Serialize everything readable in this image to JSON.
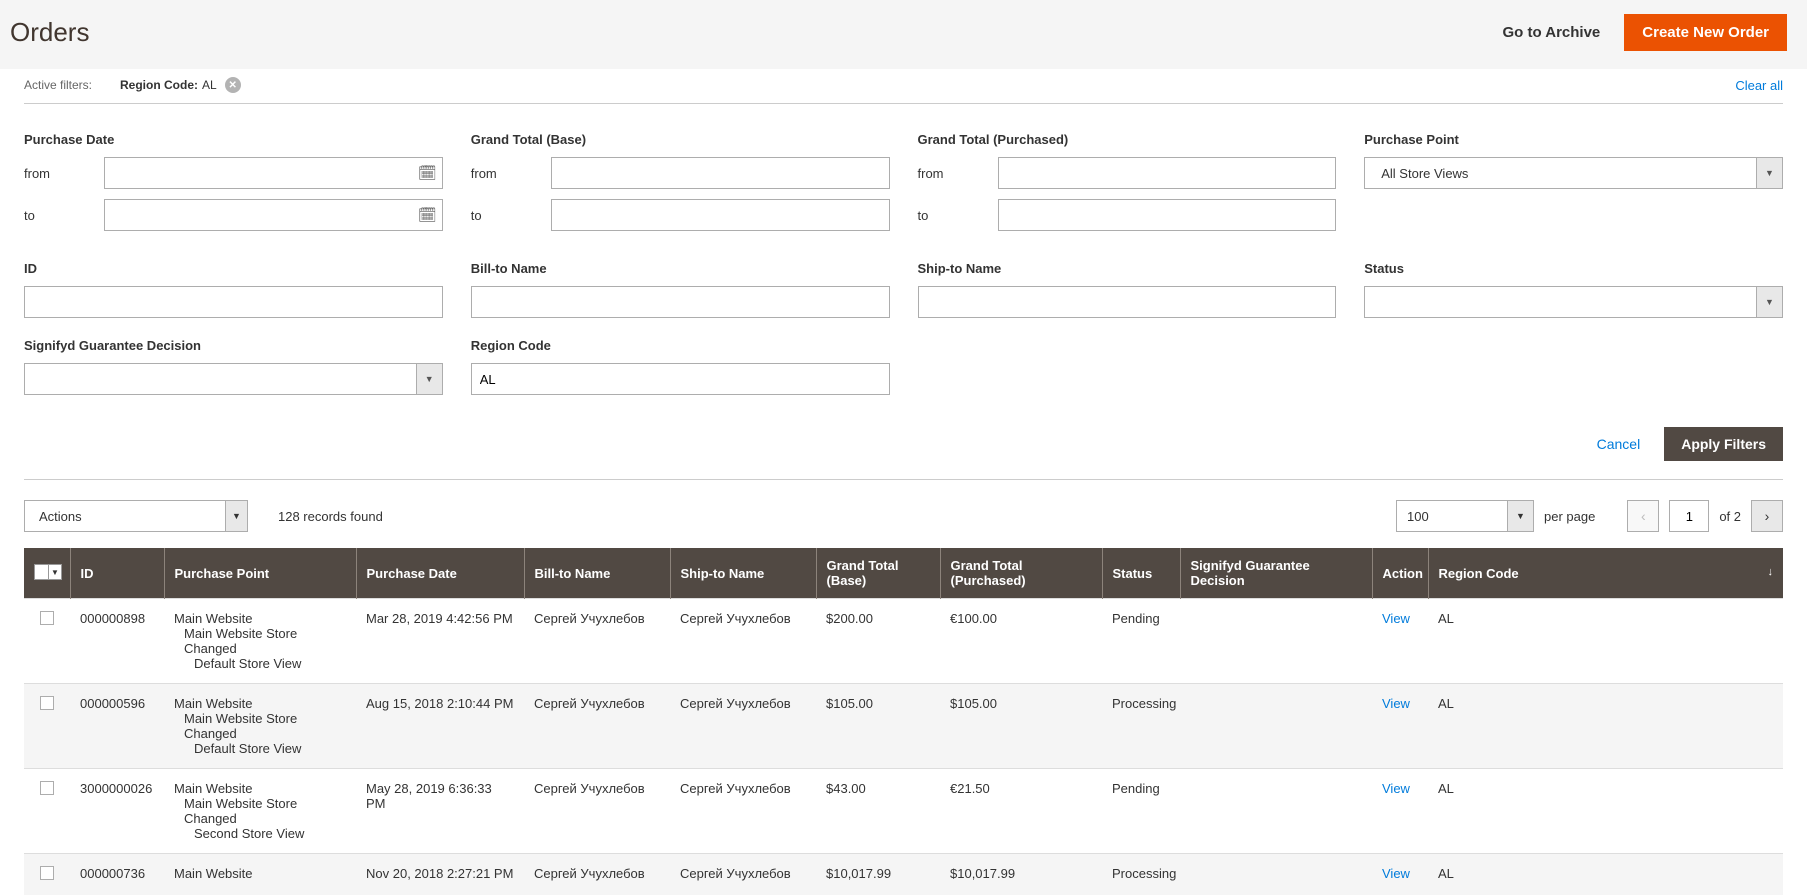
{
  "header": {
    "title": "Orders",
    "go_to_archive": "Go to Archive",
    "create_new": "Create New Order"
  },
  "active_filters": {
    "label": "Active filters:",
    "chip_key": "Region Code:",
    "chip_val": "AL",
    "clear_all": "Clear all"
  },
  "filters": {
    "purchase_date": {
      "label": "Purchase Date",
      "from": "from",
      "to": "to"
    },
    "gt_base": {
      "label": "Grand Total (Base)",
      "from": "from",
      "to": "to"
    },
    "gt_purch": {
      "label": "Grand Total (Purchased)",
      "from": "from",
      "to": "to"
    },
    "purchase_point": {
      "label": "Purchase Point",
      "value": "All Store Views"
    },
    "id": {
      "label": "ID"
    },
    "bill_to": {
      "label": "Bill-to Name"
    },
    "ship_to": {
      "label": "Ship-to Name"
    },
    "status": {
      "label": "Status"
    },
    "signifyd": {
      "label": "Signifyd Guarantee Decision"
    },
    "region_code": {
      "label": "Region Code",
      "value": "AL"
    },
    "cancel": "Cancel",
    "apply": "Apply Filters"
  },
  "toolbar": {
    "actions": "Actions",
    "records": "128 records found",
    "page_size": "100",
    "per_page": "per page",
    "page_num": "1",
    "of": "of 2"
  },
  "columns": {
    "id": "ID",
    "purchase_point": "Purchase Point",
    "purchase_date": "Purchase Date",
    "bill_to": "Bill-to Name",
    "ship_to": "Ship-to Name",
    "gt_base": "Grand Total (Base)",
    "gt_purch": "Grand Total (Purchased)",
    "status": "Status",
    "signifyd": "Signifyd Guarantee Decision",
    "action": "Action",
    "region": "Region Code"
  },
  "rows": [
    {
      "id": "000000898",
      "pp1": "Main Website",
      "pp2": "Main Website Store Changed",
      "pp3": "Default Store View",
      "date": "Mar 28, 2019 4:42:56 PM",
      "bill": "Сергей Учухлебов",
      "ship": "Сергей Учухлебов",
      "gtb": "$200.00",
      "gtp": "€100.00",
      "status": "Pending",
      "sig": "",
      "action": "View",
      "region": "AL"
    },
    {
      "id": "000000596",
      "pp1": "Main Website",
      "pp2": "Main Website Store Changed",
      "pp3": "Default Store View",
      "date": "Aug 15, 2018 2:10:44 PM",
      "bill": "Сергей Учухлебов",
      "ship": "Сергей Учухлебов",
      "gtb": "$105.00",
      "gtp": "$105.00",
      "status": "Processing",
      "sig": "",
      "action": "View",
      "region": "AL"
    },
    {
      "id": "3000000026",
      "pp1": "Main Website",
      "pp2": "Main Website Store Changed",
      "pp3": "Second Store View",
      "date": "May 28, 2019 6:36:33 PM",
      "bill": "Сергей Учухлебов",
      "ship": "Сергей Учухлебов",
      "gtb": "$43.00",
      "gtp": "€21.50",
      "status": "Pending",
      "sig": "",
      "action": "View",
      "region": "AL"
    },
    {
      "id": "000000736",
      "pp1": "Main Website",
      "pp2": "",
      "pp3": "",
      "date": "Nov 20, 2018 2:27:21 PM",
      "bill": "Сергей Учухлебов",
      "ship": "Сергей Учухлебов",
      "gtb": "$10,017.99",
      "gtp": "$10,017.99",
      "status": "Processing",
      "sig": "",
      "action": "View",
      "region": "AL"
    }
  ]
}
